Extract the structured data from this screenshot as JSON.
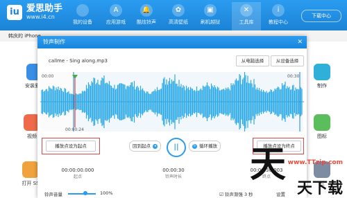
{
  "app": {
    "logo_text": "爱思助手",
    "logo_url": "www.i4.cn",
    "download_label": "下载中心"
  },
  "nav": [
    {
      "label": "我的设备",
      "icon": "apple-icon"
    },
    {
      "label": "应用游戏",
      "icon": "app-store-icon"
    },
    {
      "label": "酷炫铃声",
      "icon": "bell-icon"
    },
    {
      "label": "高清壁纸",
      "icon": "wallpaper-icon"
    },
    {
      "label": "刷机越狱",
      "icon": "box-icon"
    },
    {
      "label": "工具库",
      "icon": "tools-icon"
    },
    {
      "label": "教程中心",
      "icon": "info-icon"
    }
  ],
  "device_strip": "韩庆的 iPhone",
  "side_apps": [
    {
      "label": "安装爱思",
      "color": "#3a8ee6"
    },
    {
      "label": "视频",
      "color": "#ef6a4a"
    },
    {
      "label": "打开 SS",
      "color": "#f0a33c"
    },
    {
      "label": "制作",
      "color": "#2fb0d8"
    },
    {
      "label": "图标",
      "color": "#5bbd5b"
    },
    {
      "label": "栏",
      "color": "#7d8ca3"
    }
  ],
  "dialog": {
    "title": "铃声制作",
    "close": "✕",
    "file_name": "callme - Sing along.mp3",
    "from_pc": "从电脑选择",
    "from_device": "从设备选择",
    "time_start_top": "00:00",
    "time_end_top": "00:30",
    "time_cursor": "00:00:24",
    "set_start": "播放点设为起点",
    "set_end": "播放点设为终点",
    "back_to_start": "回到起点",
    "loop_play": "循环播放",
    "play_symbol": "||",
    "start_time": "00:00:00.000",
    "start_caption": "起点",
    "duration": "00:00:30",
    "duration_caption": "铃声时长",
    "end_time": "00:00:30.003",
    "end_caption": "终点",
    "volume_label": "铃声音量",
    "volume_value": "100%",
    "fade_label": "铃声渐强 3 秒",
    "settings_label": "设置"
  },
  "watermark": {
    "url": "www.TTzip.com",
    "big": "天",
    "small": "天下载"
  }
}
